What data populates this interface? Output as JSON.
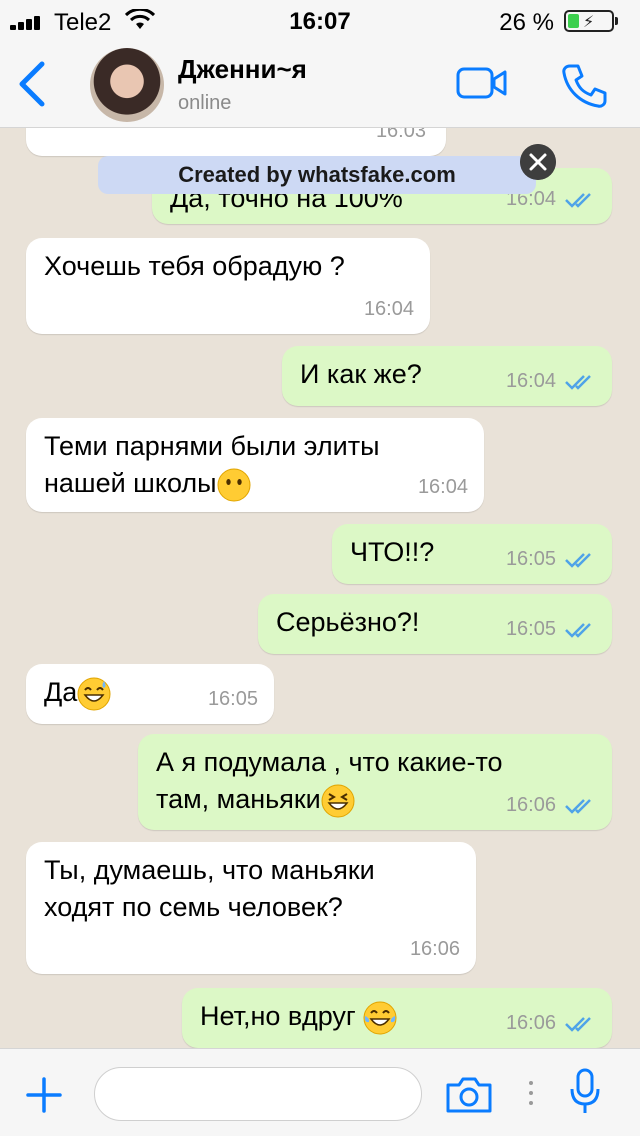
{
  "status_bar": {
    "carrier": "Tele2",
    "time": "16:07",
    "battery_percent": "26 %",
    "battery_level": 0.26
  },
  "header": {
    "contact_name": "Дженни~я",
    "contact_status": "online"
  },
  "watermark": {
    "text": "Created by whatsfake.com"
  },
  "messages": [
    {
      "direction": "in",
      "text": "",
      "time": "16:03"
    },
    {
      "direction": "out",
      "text": "Да, точно на 100%",
      "time": "16:04",
      "read": true
    },
    {
      "direction": "in",
      "text": "Хочешь тебя обрадую ?",
      "time": "16:04"
    },
    {
      "direction": "out",
      "text": "И как же?",
      "time": "16:04",
      "read": true
    },
    {
      "direction": "in",
      "text": "Теми парнями были элиты\nнашей школы",
      "time": "16:04",
      "emoji": "hushed-face"
    },
    {
      "direction": "out",
      "text": "ЧТО!!?",
      "time": "16:05",
      "read": true
    },
    {
      "direction": "out",
      "text": "Серьёзно?!",
      "time": "16:05",
      "read": true
    },
    {
      "direction": "in",
      "text": "Да",
      "time": "16:05",
      "emoji": "grinning-sweat"
    },
    {
      "direction": "out",
      "text": "А я подумала , что какие-то\nтам, маньяки",
      "time": "16:06",
      "read": true,
      "emoji": "laughing-squint"
    },
    {
      "direction": "in",
      "text": "Ты, думаешь, что маньяки\nходят по семь человек?",
      "time": "16:06"
    },
    {
      "direction": "out",
      "text": "Нет,но вдруг ",
      "time": "16:06",
      "read": true,
      "emoji": "tears-of-joy"
    }
  ],
  "composer": {
    "placeholder": ""
  },
  "colors": {
    "accent": "#0a7cff",
    "outgoing_bubble": "#dcf8c6",
    "incoming_bubble": "#ffffff",
    "read_ticks": "#4fa3e8",
    "chat_background": "#e9e2d8"
  }
}
